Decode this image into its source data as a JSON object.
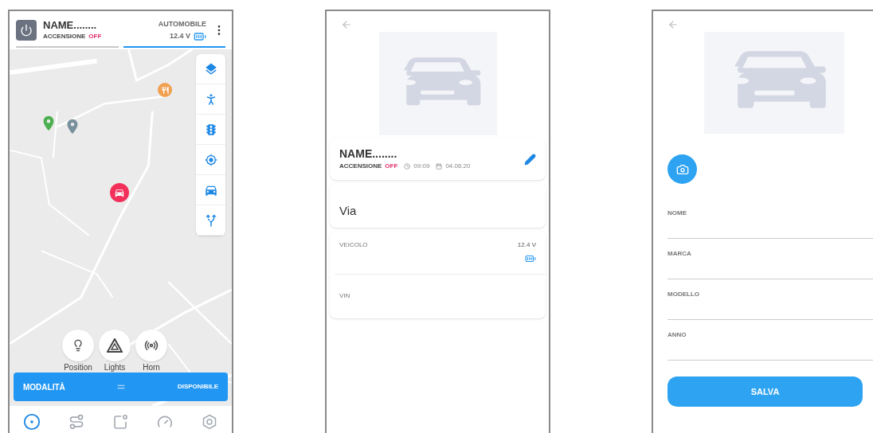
{
  "map_screen": {
    "header": {
      "name": "NAME........",
      "ignition_label": "ACCENSIONE",
      "ignition_state": "OFF",
      "vehicle_type": "AUTOMOBILE",
      "voltage": "12.4 V"
    },
    "map_tools": [
      {
        "kind": "layers"
      },
      {
        "kind": "person"
      },
      {
        "kind": "traffic"
      },
      {
        "kind": "locate"
      },
      {
        "kind": "car"
      },
      {
        "kind": "route"
      }
    ],
    "quick_actions": [
      {
        "kind": "bulb",
        "label": "Position"
      },
      {
        "kind": "hazard",
        "label": "Lights"
      },
      {
        "kind": "horn",
        "label": "Horn"
      }
    ],
    "mode_bar": {
      "label": "MODALITÀ",
      "value": "DISPONIBILE"
    },
    "bottom_nav": [
      {
        "kind": "live",
        "selected": true
      },
      {
        "kind": "routes",
        "selected": false
      },
      {
        "kind": "notify",
        "selected": false
      },
      {
        "kind": "speed",
        "selected": false
      },
      {
        "kind": "settings",
        "selected": false
      }
    ]
  },
  "detail_screen": {
    "name": "NAME........",
    "ignition_label": "ACCENSIONE",
    "ignition_state": "OFF",
    "time": "09:09",
    "date": "04.06.20",
    "address": "Via",
    "vehicle_label": "VEICOLO",
    "voltage": "12.4 V",
    "vin_label": "VIN"
  },
  "edit_screen": {
    "fields": [
      {
        "label": "NOME"
      },
      {
        "label": "MARCA"
      },
      {
        "label": "MODELLO"
      },
      {
        "label": "ANNO"
      }
    ],
    "save": "SALVA"
  }
}
